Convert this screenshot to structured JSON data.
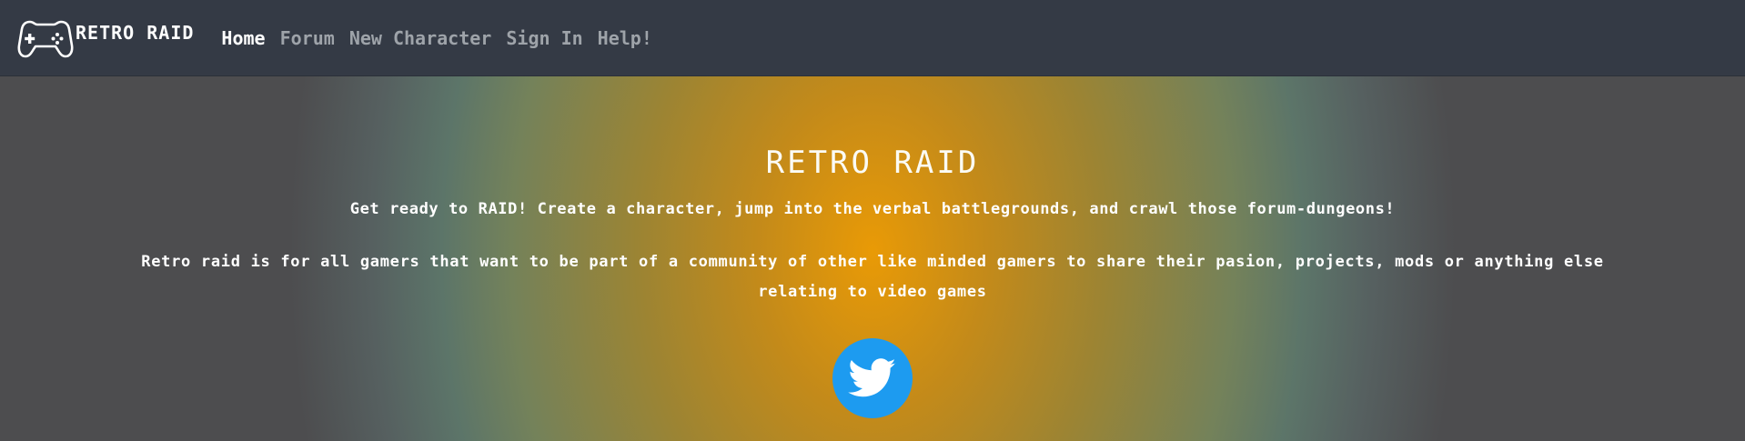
{
  "navbar": {
    "brand_name": "RETRO RAID",
    "brand_icon": "gamepad-icon",
    "links": [
      {
        "label": "Home",
        "active": true
      },
      {
        "label": "Forum",
        "active": false
      },
      {
        "label": "New Character",
        "active": false
      },
      {
        "label": "Sign In",
        "active": false
      },
      {
        "label": "Help!",
        "active": false
      }
    ]
  },
  "hero": {
    "title": "RETRO RAID",
    "tagline": "Get ready to RAID! Create a character, jump into the verbal battlegrounds, and crawl those forum-dungeons!",
    "description": "Retro raid is for all gamers that want to be part of a community of other like minded gamers to share their pasion, projects, mods or anything else relating to video games",
    "social_icon": "twitter-icon"
  },
  "colors": {
    "navbar_bg": "#343a45",
    "nav_link": "#9ea3a9",
    "nav_link_active": "#ffffff",
    "hero_center": "#e99a06",
    "hero_edge": "#4d4d4f",
    "twitter_blue": "#1d9bf0"
  }
}
